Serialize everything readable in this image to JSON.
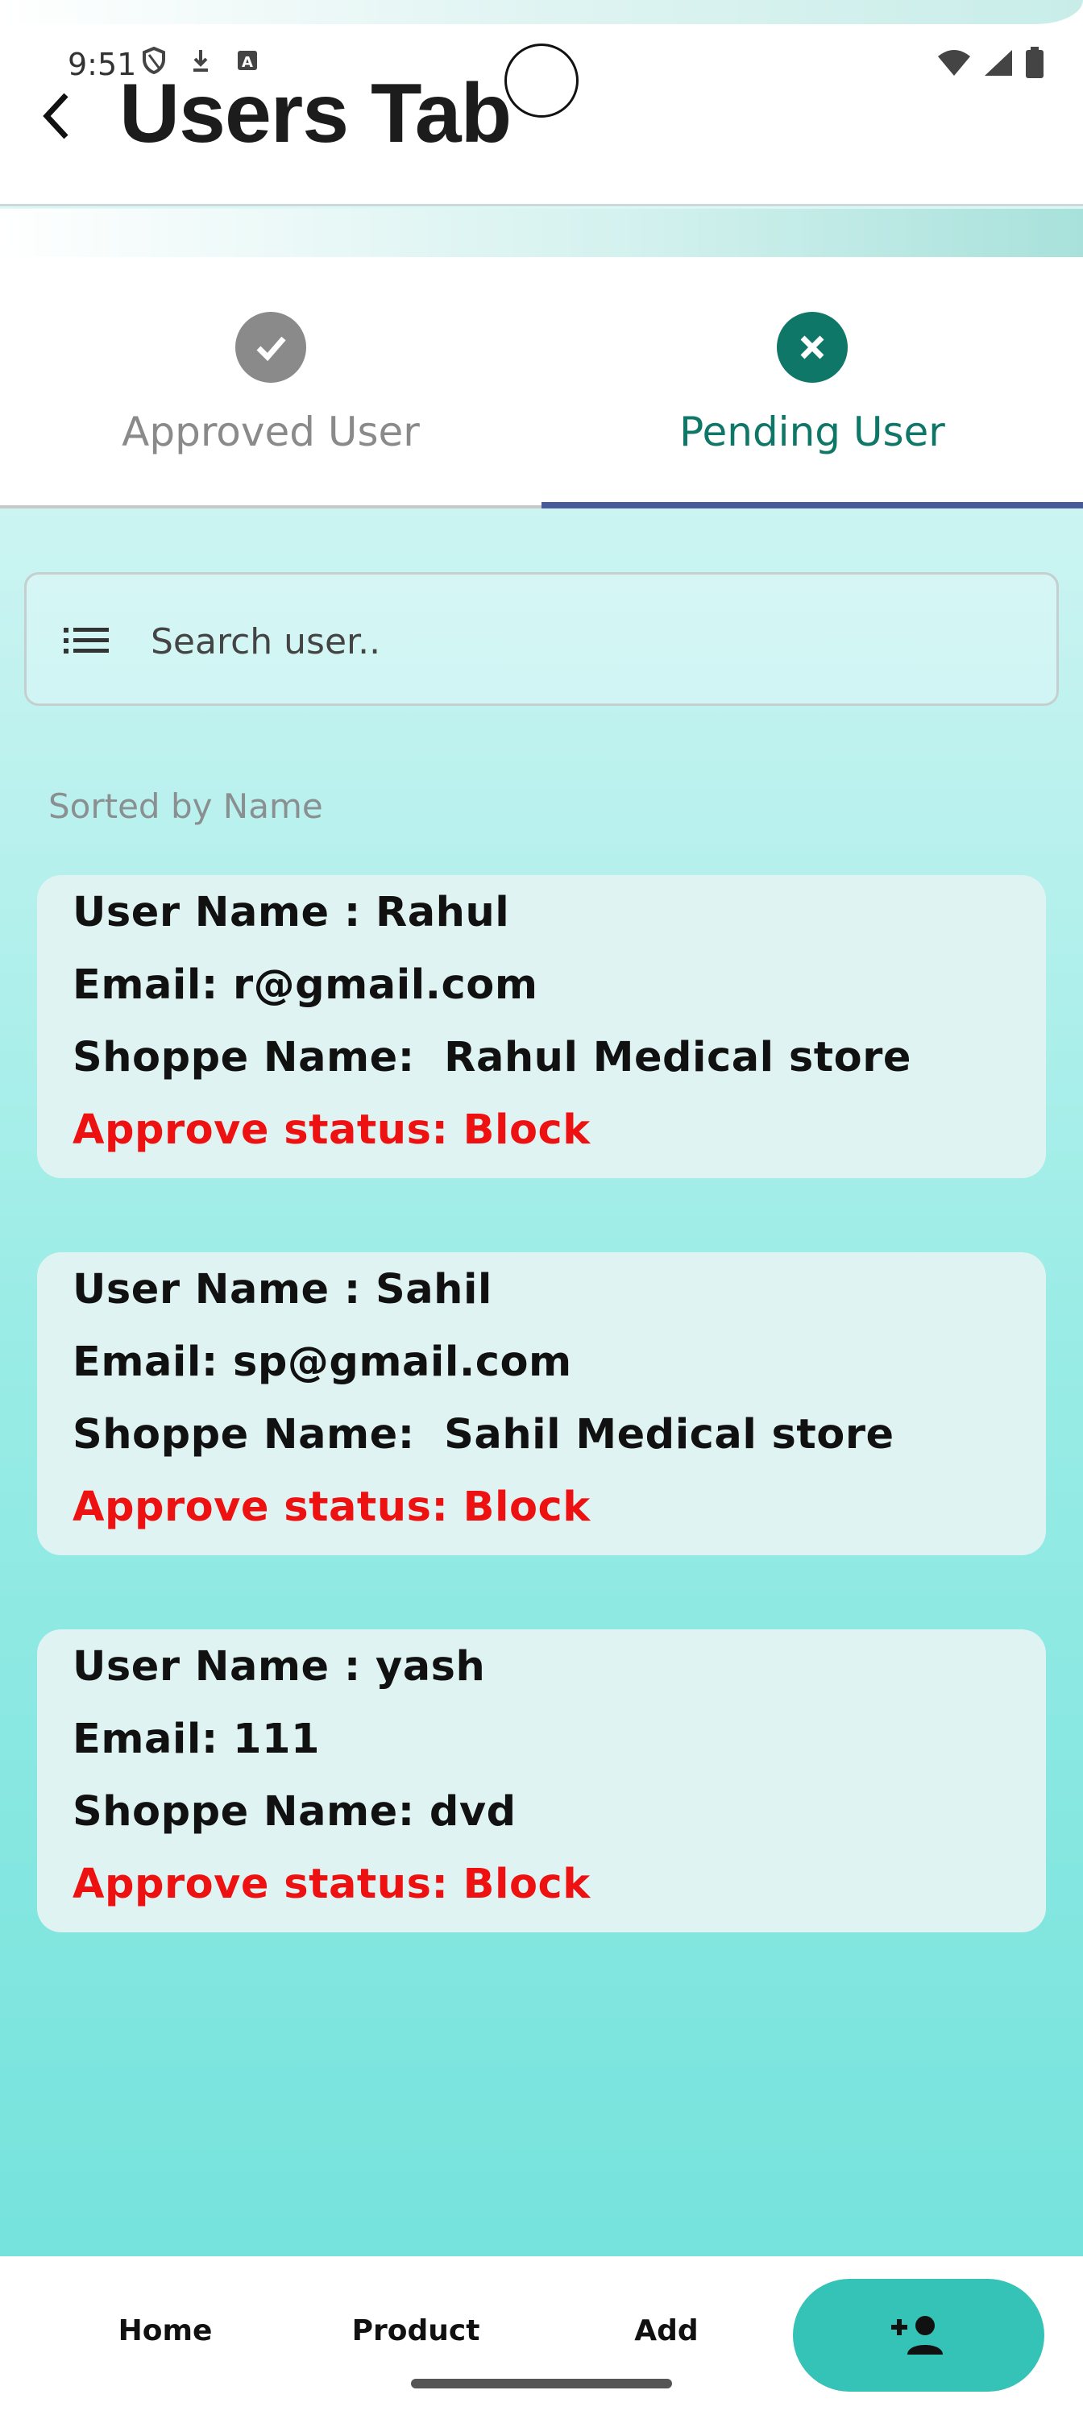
{
  "status_bar": {
    "time": "9:51"
  },
  "header": {
    "title": "Users Tab"
  },
  "tabs": [
    {
      "label": "Approved User",
      "icon": "check-circle-icon",
      "selected": false
    },
    {
      "label": "Pending User",
      "icon": "close-circle-icon",
      "selected": true
    }
  ],
  "search": {
    "placeholder": "Search user.."
  },
  "sort_label": "Sorted by Name",
  "users": [
    {
      "name": "User Name : Rahul",
      "email": "Email: r@gmail.com",
      "shop": "Shoppe Name:  Rahul Medical store",
      "status": "Approve status: Block"
    },
    {
      "name": "User Name : Sahil",
      "email": "Email: sp@gmail.com",
      "shop": "Shoppe Name:  Sahil Medical store",
      "status": "Approve status: Block"
    },
    {
      "name": "User Name : yash",
      "email": "Email: 111",
      "shop": "Shoppe Name: dvd",
      "status": "Approve status: Block"
    }
  ],
  "bottom_nav": {
    "home": "Home",
    "product": "Product",
    "add": "Add",
    "fab_icon": "add-user-icon"
  },
  "colors": {
    "accent": "#0f7767",
    "fab": "#35c3b7",
    "status_red": "#ee1111",
    "tab_underline": "#475a9a"
  }
}
